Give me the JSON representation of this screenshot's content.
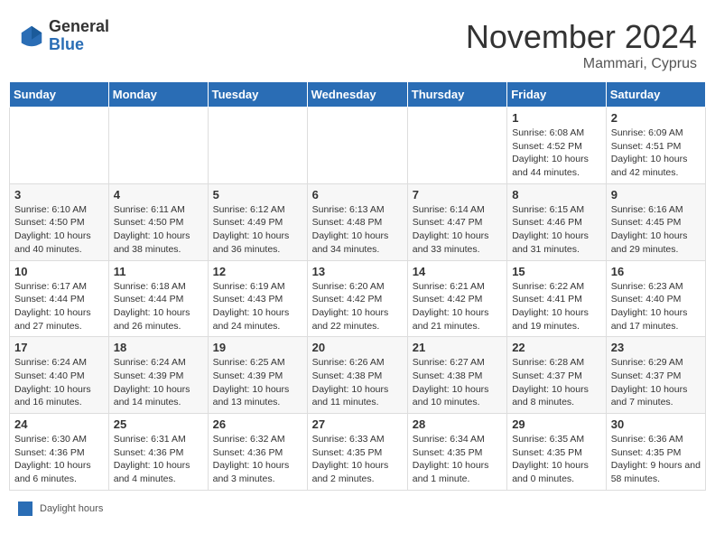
{
  "header": {
    "logo_general": "General",
    "logo_blue": "Blue",
    "month_title": "November 2024",
    "location": "Mammari, Cyprus"
  },
  "calendar": {
    "weekdays": [
      "Sunday",
      "Monday",
      "Tuesday",
      "Wednesday",
      "Thursday",
      "Friday",
      "Saturday"
    ],
    "weeks": [
      [
        {
          "day": "",
          "info": ""
        },
        {
          "day": "",
          "info": ""
        },
        {
          "day": "",
          "info": ""
        },
        {
          "day": "",
          "info": ""
        },
        {
          "day": "",
          "info": ""
        },
        {
          "day": "1",
          "info": "Sunrise: 6:08 AM\nSunset: 4:52 PM\nDaylight: 10 hours and 44 minutes."
        },
        {
          "day": "2",
          "info": "Sunrise: 6:09 AM\nSunset: 4:51 PM\nDaylight: 10 hours and 42 minutes."
        }
      ],
      [
        {
          "day": "3",
          "info": "Sunrise: 6:10 AM\nSunset: 4:50 PM\nDaylight: 10 hours and 40 minutes."
        },
        {
          "day": "4",
          "info": "Sunrise: 6:11 AM\nSunset: 4:50 PM\nDaylight: 10 hours and 38 minutes."
        },
        {
          "day": "5",
          "info": "Sunrise: 6:12 AM\nSunset: 4:49 PM\nDaylight: 10 hours and 36 minutes."
        },
        {
          "day": "6",
          "info": "Sunrise: 6:13 AM\nSunset: 4:48 PM\nDaylight: 10 hours and 34 minutes."
        },
        {
          "day": "7",
          "info": "Sunrise: 6:14 AM\nSunset: 4:47 PM\nDaylight: 10 hours and 33 minutes."
        },
        {
          "day": "8",
          "info": "Sunrise: 6:15 AM\nSunset: 4:46 PM\nDaylight: 10 hours and 31 minutes."
        },
        {
          "day": "9",
          "info": "Sunrise: 6:16 AM\nSunset: 4:45 PM\nDaylight: 10 hours and 29 minutes."
        }
      ],
      [
        {
          "day": "10",
          "info": "Sunrise: 6:17 AM\nSunset: 4:44 PM\nDaylight: 10 hours and 27 minutes."
        },
        {
          "day": "11",
          "info": "Sunrise: 6:18 AM\nSunset: 4:44 PM\nDaylight: 10 hours and 26 minutes."
        },
        {
          "day": "12",
          "info": "Sunrise: 6:19 AM\nSunset: 4:43 PM\nDaylight: 10 hours and 24 minutes."
        },
        {
          "day": "13",
          "info": "Sunrise: 6:20 AM\nSunset: 4:42 PM\nDaylight: 10 hours and 22 minutes."
        },
        {
          "day": "14",
          "info": "Sunrise: 6:21 AM\nSunset: 4:42 PM\nDaylight: 10 hours and 21 minutes."
        },
        {
          "day": "15",
          "info": "Sunrise: 6:22 AM\nSunset: 4:41 PM\nDaylight: 10 hours and 19 minutes."
        },
        {
          "day": "16",
          "info": "Sunrise: 6:23 AM\nSunset: 4:40 PM\nDaylight: 10 hours and 17 minutes."
        }
      ],
      [
        {
          "day": "17",
          "info": "Sunrise: 6:24 AM\nSunset: 4:40 PM\nDaylight: 10 hours and 16 minutes."
        },
        {
          "day": "18",
          "info": "Sunrise: 6:24 AM\nSunset: 4:39 PM\nDaylight: 10 hours and 14 minutes."
        },
        {
          "day": "19",
          "info": "Sunrise: 6:25 AM\nSunset: 4:39 PM\nDaylight: 10 hours and 13 minutes."
        },
        {
          "day": "20",
          "info": "Sunrise: 6:26 AM\nSunset: 4:38 PM\nDaylight: 10 hours and 11 minutes."
        },
        {
          "day": "21",
          "info": "Sunrise: 6:27 AM\nSunset: 4:38 PM\nDaylight: 10 hours and 10 minutes."
        },
        {
          "day": "22",
          "info": "Sunrise: 6:28 AM\nSunset: 4:37 PM\nDaylight: 10 hours and 8 minutes."
        },
        {
          "day": "23",
          "info": "Sunrise: 6:29 AM\nSunset: 4:37 PM\nDaylight: 10 hours and 7 minutes."
        }
      ],
      [
        {
          "day": "24",
          "info": "Sunrise: 6:30 AM\nSunset: 4:36 PM\nDaylight: 10 hours and 6 minutes."
        },
        {
          "day": "25",
          "info": "Sunrise: 6:31 AM\nSunset: 4:36 PM\nDaylight: 10 hours and 4 minutes."
        },
        {
          "day": "26",
          "info": "Sunrise: 6:32 AM\nSunset: 4:36 PM\nDaylight: 10 hours and 3 minutes."
        },
        {
          "day": "27",
          "info": "Sunrise: 6:33 AM\nSunset: 4:35 PM\nDaylight: 10 hours and 2 minutes."
        },
        {
          "day": "28",
          "info": "Sunrise: 6:34 AM\nSunset: 4:35 PM\nDaylight: 10 hours and 1 minute."
        },
        {
          "day": "29",
          "info": "Sunrise: 6:35 AM\nSunset: 4:35 PM\nDaylight: 10 hours and 0 minutes."
        },
        {
          "day": "30",
          "info": "Sunrise: 6:36 AM\nSunset: 4:35 PM\nDaylight: 9 hours and 58 minutes."
        }
      ]
    ]
  },
  "legend": {
    "color_label": "Daylight hours"
  }
}
